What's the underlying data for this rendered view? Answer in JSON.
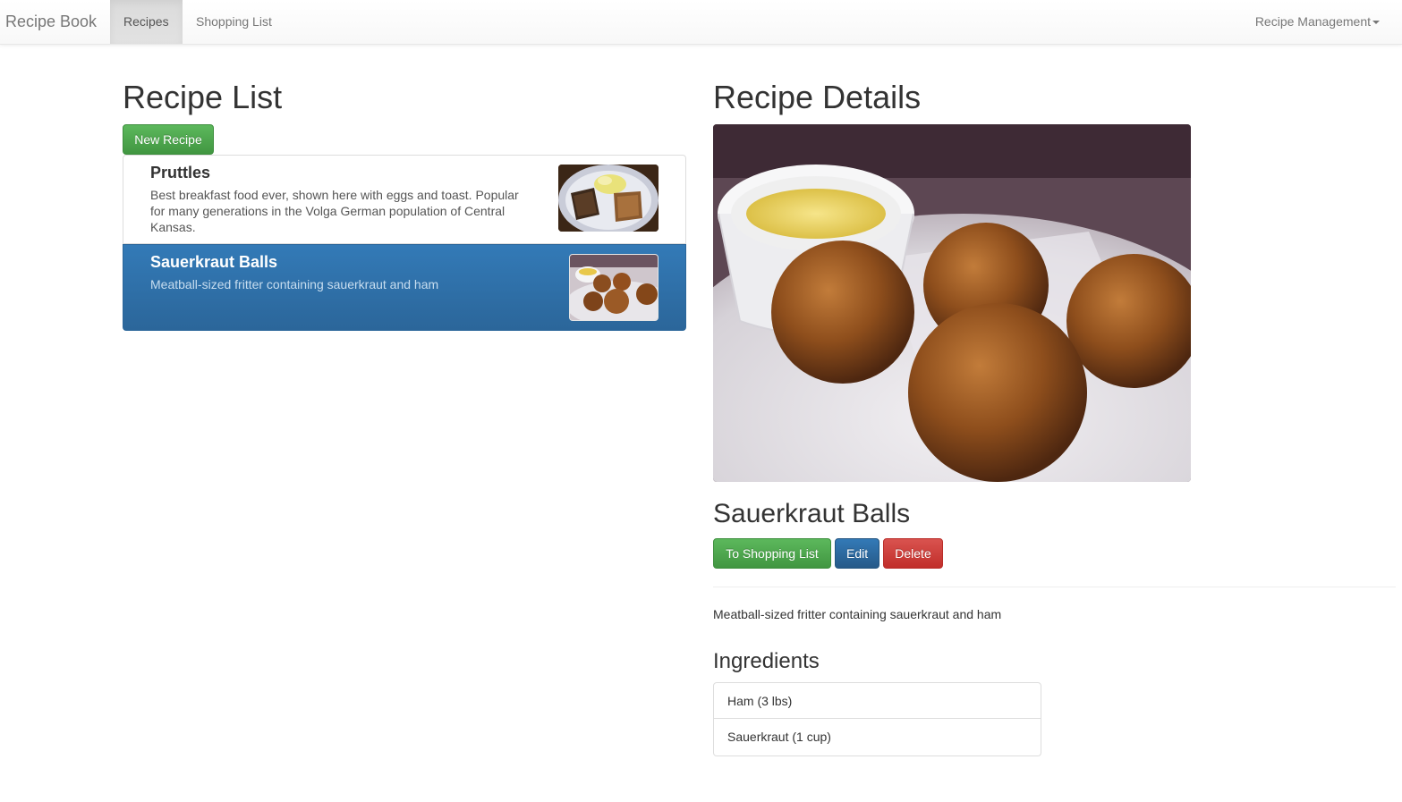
{
  "navbar": {
    "brand": "Recipe Book",
    "tabs": [
      {
        "label": "Recipes",
        "active": true
      },
      {
        "label": "Shopping List",
        "active": false
      }
    ],
    "dropdown_label": "Recipe Management"
  },
  "recipe_list": {
    "heading": "Recipe List",
    "new_button": "New Recipe",
    "items": [
      {
        "name": "Pruttles",
        "description": "Best breakfast food ever, shown here with eggs and toast. Popular for many generations in the Volga German population of Central Kansas.",
        "selected": false,
        "image": "pruttles-breakfast-photo"
      },
      {
        "name": "Sauerkraut Balls",
        "description": "Meatball-sized fritter containing sauerkraut and ham",
        "selected": true,
        "image": "sauerkraut-balls-photo"
      }
    ]
  },
  "recipe_details": {
    "heading": "Recipe Details",
    "image": "sauerkraut-balls-photo",
    "name": "Sauerkraut Balls",
    "buttons": {
      "shopping": "To Shopping List",
      "edit": "Edit",
      "delete": "Delete"
    },
    "description": "Meatball-sized fritter containing sauerkraut and ham",
    "ingredients_heading": "Ingredients",
    "ingredients": [
      {
        "label": "Ham (3 lbs)"
      },
      {
        "label": "Sauerkraut (1 cup)"
      }
    ]
  },
  "colors": {
    "success": "#5cb85c",
    "primary": "#337ab7",
    "danger": "#d9534f",
    "selected_bg": "#337ab7"
  }
}
